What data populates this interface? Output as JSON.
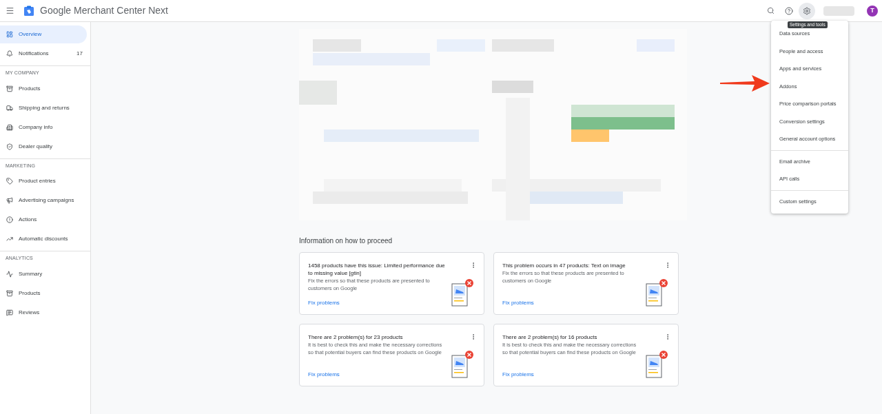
{
  "header": {
    "title": "Google Merchant Center Next",
    "avatar": "T",
    "tooltip": "Settings and tools"
  },
  "sidebar": {
    "sections": [
      {
        "items": [
          {
            "label": "Overview",
            "selected": true
          },
          {
            "label": "Notifications",
            "selected": false,
            "count": "17"
          }
        ]
      },
      {
        "heading": "MY COMPANY",
        "items": [
          {
            "label": "Products",
            "selected": false
          },
          {
            "label": "Shipping and returns",
            "selected": false
          },
          {
            "label": "Company info",
            "selected": false
          },
          {
            "label": "Dealer quality",
            "selected": false
          }
        ]
      },
      {
        "heading": "MARKETING",
        "items": [
          {
            "label": "Product entries",
            "selected": false
          },
          {
            "label": "Advertising campaigns",
            "selected": false
          },
          {
            "label": "Actions",
            "selected": false
          },
          {
            "label": "Automatic discounts",
            "selected": false
          }
        ]
      },
      {
        "heading": "ANALYTICS",
        "items": [
          {
            "label": "Summary",
            "selected": false
          },
          {
            "label": "Products",
            "selected": false
          },
          {
            "label": "Reviews",
            "selected": false
          }
        ]
      }
    ]
  },
  "section_title": "Information on how to proceed",
  "cards": [
    {
      "title": "1458 products have this issue: Limited performance due to missing value [gtin]",
      "description": "Fix the errors so that these products are presented to customers on Google",
      "link": "Fix problems"
    },
    {
      "title": "This problem occurs in 47 products: Text on image",
      "description": "Fix the errors so that these products are presented to customers on Google",
      "link": "Fix problems"
    },
    {
      "title": "There are 2 problem(s) for 23 products",
      "description": "It is best to check this and make the necessary corrections so that potential buyers can find these products on Google",
      "link": "Fix problems"
    },
    {
      "title": "There are 2 problem(s) for 16 products",
      "description": "It is best to check this and make the necessary corrections so that potential buyers can find these products on Google",
      "link": "Fix problems"
    }
  ],
  "settings_menu": {
    "groups": [
      [
        "Data sources",
        "People and access",
        "Apps and services",
        "Addons",
        "Price comparison portals",
        "Conversion settings",
        "General account options"
      ],
      [
        "Email archive",
        "API calls"
      ],
      [
        "Custom settings"
      ]
    ]
  }
}
